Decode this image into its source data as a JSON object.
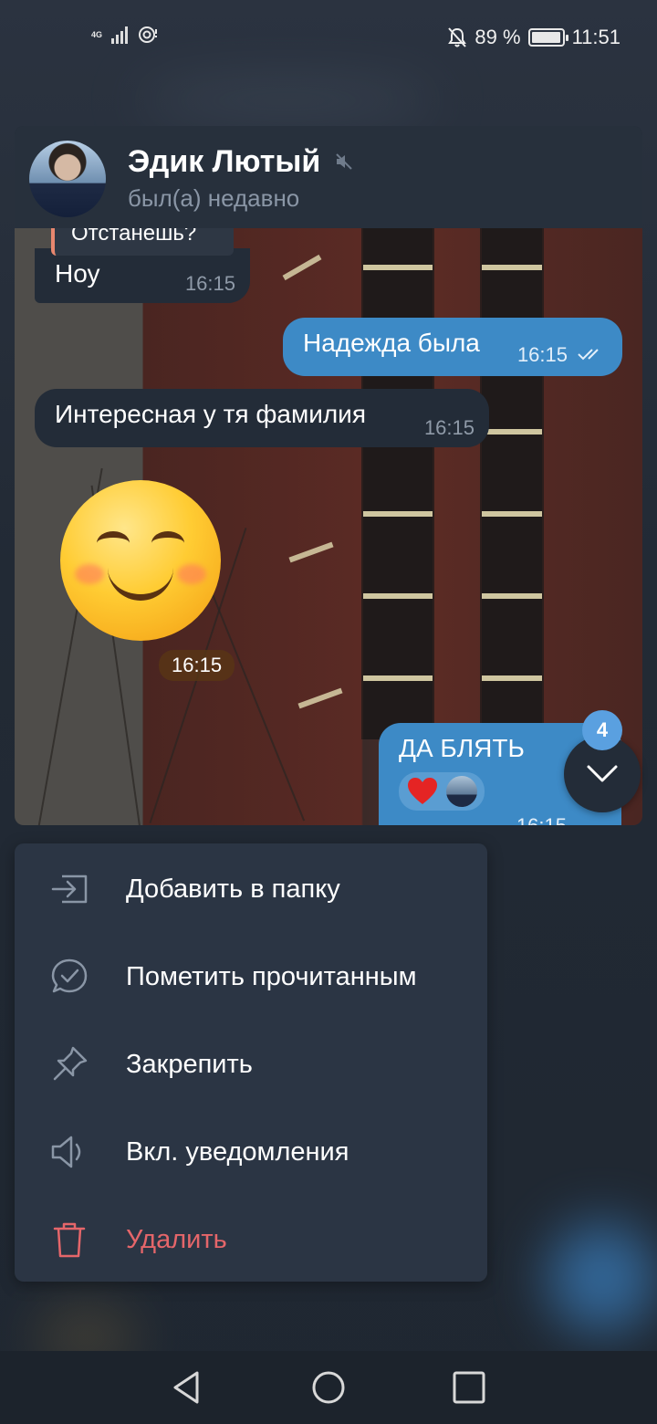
{
  "status_bar": {
    "network": "4G",
    "battery_percent": "89 %",
    "battery_level": 0.89,
    "time": "11:51"
  },
  "chat": {
    "name": "Эдик Лютый",
    "status": "был(а) недавно",
    "reply_snippet": "Отстанешь?",
    "messages": [
      {
        "direction": "in",
        "text": "Ноу",
        "time": "16:15"
      },
      {
        "direction": "out",
        "text": "Надежда была",
        "time": "16:15"
      },
      {
        "direction": "in",
        "text": "Интересная у тя фамилия",
        "time": "16:15"
      },
      {
        "direction": "in",
        "type": "sticker",
        "emoji": "smiling-face",
        "time": "16:15"
      },
      {
        "direction": "out",
        "text": "ДА БЛЯТЬ",
        "time": "16:15",
        "reaction": "heart"
      }
    ],
    "unread_count": "4"
  },
  "menu": {
    "items": [
      {
        "label": "Добавить в папку",
        "icon": "folder-add-icon"
      },
      {
        "label": "Пометить прочитанным",
        "icon": "chat-check-icon"
      },
      {
        "label": "Закрепить",
        "icon": "pin-icon"
      },
      {
        "label": "Вкл. уведомления",
        "icon": "speaker-icon"
      },
      {
        "label": "Удалить",
        "icon": "trash-icon",
        "danger": true
      }
    ]
  },
  "colors": {
    "accent": "#3d8ac6",
    "danger": "#e5666a",
    "menu_bg": "#2b3544"
  }
}
